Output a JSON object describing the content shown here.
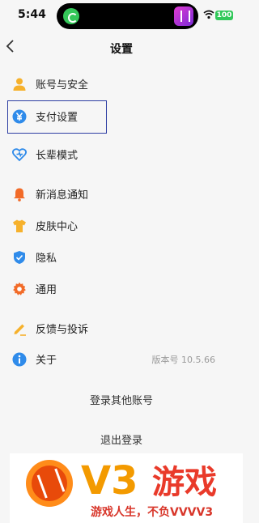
{
  "status": {
    "time": "5:44",
    "battery": "100"
  },
  "nav": {
    "title": "设置"
  },
  "menu": [
    {
      "label": "账号与安全",
      "icon": "user-icon",
      "color": "#f6b12c"
    },
    {
      "label": "支付设置",
      "icon": "yuan-icon",
      "color": "#2f8bea"
    },
    {
      "label": "长辈模式",
      "icon": "heart-icon",
      "color": "#2f8bea"
    },
    {
      "label": "新消息通知",
      "icon": "bell-icon",
      "color": "#f26b28"
    },
    {
      "label": "皮肤中心",
      "icon": "tshirt-icon",
      "color": "#f6b12c"
    },
    {
      "label": "隐私",
      "icon": "shield-icon",
      "color": "#2f8bea"
    },
    {
      "label": "通用",
      "icon": "gear-icon",
      "color": "#f26b28"
    },
    {
      "label": "反馈与投诉",
      "icon": "pencil-icon",
      "color": "#f6b12c"
    },
    {
      "label": "关于",
      "icon": "info-icon",
      "color": "#2f8bea",
      "right": "版本号 10.5.66"
    }
  ],
  "actions": {
    "switch_account": "登录其他账号",
    "logout": "退出登录"
  },
  "banner": {
    "brand": "V3",
    "brand_cn": "游戏",
    "tagline": "游戏人生，不负VVVV3"
  }
}
